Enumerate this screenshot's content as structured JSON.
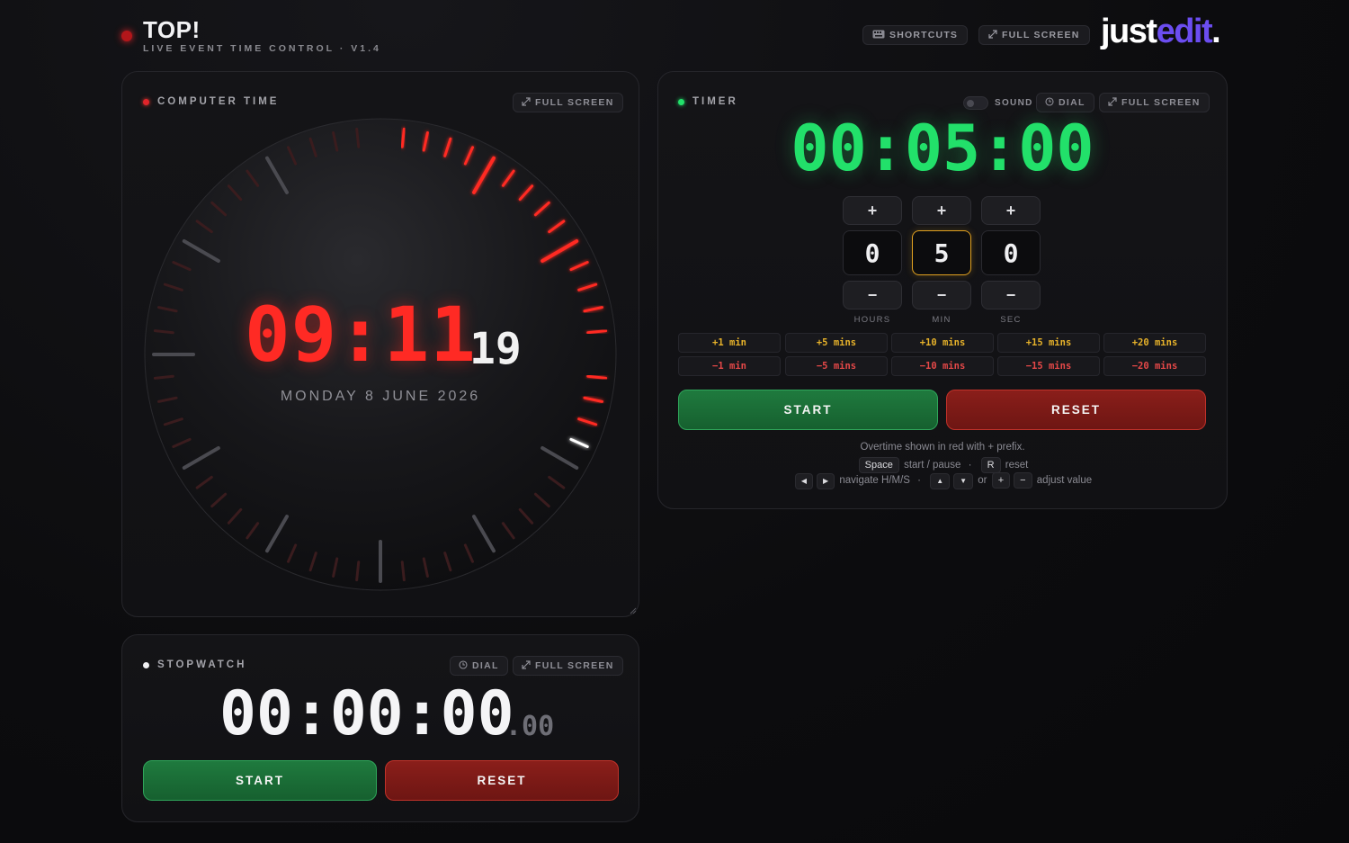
{
  "header": {
    "title": "TOP!",
    "subtitle": "LIVE EVENT TIME CONTROL · V1.4",
    "shortcuts_label": "SHORTCUTS",
    "fullscreen_label": "FULL SCREEN",
    "logo_just": "just",
    "logo_edit": "edit",
    "logo_dot": "."
  },
  "computer_time": {
    "label": "COMPUTER TIME",
    "fullscreen_label": "FULL SCREEN",
    "hours_minutes": "09:11",
    "seconds": "19",
    "seconds_value": 19,
    "date": "MONDAY 8 JUNE 2026",
    "accent_color": "#ff2a24"
  },
  "timer": {
    "label": "TIMER",
    "sound_label": "SOUND",
    "dial_label": "DIAL",
    "fullscreen_label": "FULL SCREEN",
    "display": "00:05:00",
    "hours": "0",
    "minutes": "5",
    "seconds": "0",
    "plus_glyph": "+",
    "minus_glyph": "−",
    "unit_hours": "HOURS",
    "unit_min": "MIN",
    "unit_sec": "SEC",
    "quick_add": [
      "+1 min",
      "+5 mins",
      "+10 mins",
      "+15 mins",
      "+20 mins"
    ],
    "quick_sub": [
      "−1 min",
      "−5 mins",
      "−10 mins",
      "−15 mins",
      "−20 mins"
    ],
    "start_label": "START",
    "reset_label": "RESET",
    "help_overtime": "Overtime shown in red with + prefix.",
    "key_space": "Space",
    "help_start_pause": "start / pause",
    "key_r": "R",
    "help_reset": "reset",
    "key_left": "◀",
    "key_right": "▶",
    "help_navigate": "navigate H/M/S",
    "key_up": "▲",
    "key_down": "▼",
    "help_or": "or",
    "key_plus": "+",
    "key_minus": "−",
    "help_adjust": "adjust value",
    "help_sep": "·",
    "accent_color": "#22e06a"
  },
  "stopwatch": {
    "label": "STOPWATCH",
    "dial_label": "DIAL",
    "fullscreen_label": "FULL SCREEN",
    "display": "00:00:00",
    "fraction": ".00",
    "start_label": "START",
    "reset_label": "RESET"
  },
  "icons": {
    "keyboard": "keyboard-icon",
    "expand": "expand-icon",
    "dial": "dial-icon"
  }
}
